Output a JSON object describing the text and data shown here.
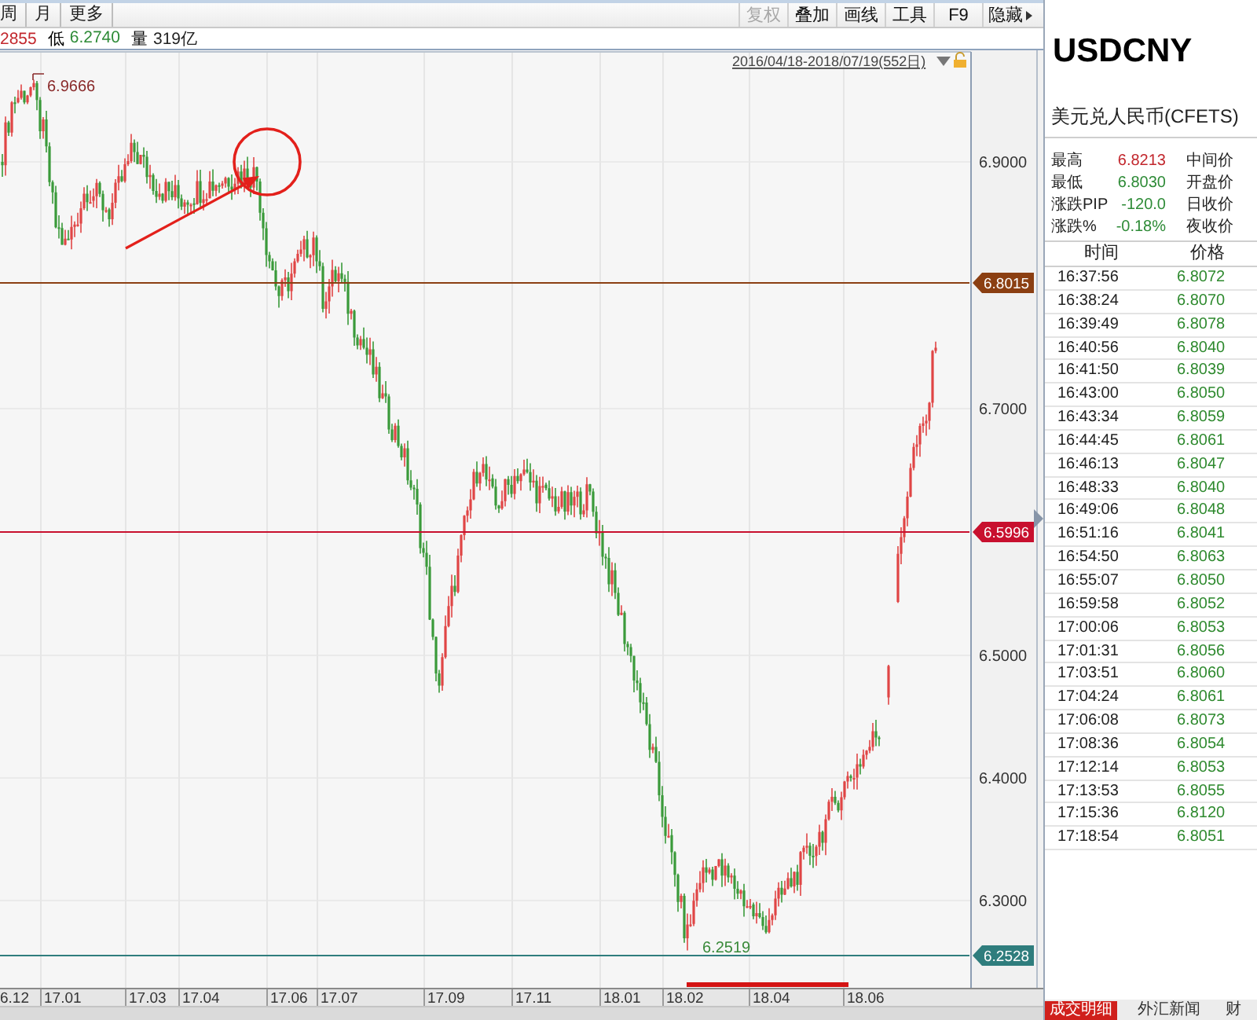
{
  "toolbar": {
    "period_tabs": [
      {
        "label": "周",
        "selected": false
      },
      {
        "label": "月",
        "selected": false
      },
      {
        "label": "更多",
        "selected": false
      }
    ],
    "buttons": [
      {
        "label": "复权",
        "kind": "plain",
        "disabled": true
      },
      {
        "label": "叠加",
        "kind": "plain",
        "disabled": false
      },
      {
        "label": "画线",
        "kind": "plain",
        "disabled": false
      },
      {
        "label": "工具",
        "kind": "plain",
        "disabled": false
      },
      {
        "label": "F9",
        "kind": "plain",
        "disabled": false
      },
      {
        "label": "隐藏",
        "kind": "menu",
        "disabled": false
      }
    ]
  },
  "quote_bar": [
    {
      "value": "2855",
      "color": "#c2272d"
    },
    {
      "label": "低",
      "value": "6.2740",
      "color": "#2e8b37"
    },
    {
      "label": "量",
      "value": "319亿",
      "color": "#222222"
    }
  ],
  "chart": {
    "range_label": "2016/04/18-2018/07/19(552日)",
    "price_ticks": [
      "6.9000",
      "6.7000",
      "6.5000",
      "6.4000",
      "6.3000"
    ],
    "reference_lines": [
      {
        "value": "6.8015",
        "color": "#8b3f12"
      },
      {
        "value": "6.5996",
        "color": "#c8102e"
      },
      {
        "value": "6.2528",
        "color": "#2f7d7d"
      }
    ],
    "high_label": "6.9666",
    "low_label": "6.2519",
    "time_ticks": [
      "6.12",
      "17.01",
      "17.03",
      "17.04",
      "17.06",
      "17.07",
      "17.09",
      "17.11",
      "18.01",
      "18.02",
      "18.04",
      "18.06"
    ]
  },
  "quote_panel": {
    "symbol": "USDCNY",
    "name": "美元兑人民币(CFETS)",
    "stats": [
      {
        "label": "最高",
        "value": "6.8213",
        "color": "#c2272d",
        "label_2": "中间价"
      },
      {
        "label": "最低",
        "value": "6.8030",
        "color": "#2e8b37",
        "label_2": "开盘价"
      },
      {
        "label": "涨跌PIP",
        "value": "-120.0",
        "color": "#2e8b37",
        "label_2": "日收价"
      },
      {
        "label": "涨跌%",
        "value": "-0.18%",
        "color": "#2e8b37",
        "label_2": "夜收价"
      }
    ],
    "columns": [
      "时间",
      "价格"
    ],
    "trades": [
      {
        "time": "16:37:56",
        "price": "6.8072"
      },
      {
        "time": "16:38:24",
        "price": "6.8070"
      },
      {
        "time": "16:39:49",
        "price": "6.8078"
      },
      {
        "time": "16:40:56",
        "price": "6.8040"
      },
      {
        "time": "16:41:50",
        "price": "6.8039"
      },
      {
        "time": "16:43:00",
        "price": "6.8050"
      },
      {
        "time": "16:43:34",
        "price": "6.8059"
      },
      {
        "time": "16:44:45",
        "price": "6.8061"
      },
      {
        "time": "16:46:13",
        "price": "6.8047"
      },
      {
        "time": "16:48:33",
        "price": "6.8040"
      },
      {
        "time": "16:49:06",
        "price": "6.8048"
      },
      {
        "time": "16:51:16",
        "price": "6.8041"
      },
      {
        "time": "16:54:50",
        "price": "6.8063"
      },
      {
        "time": "16:55:07",
        "price": "6.8050"
      },
      {
        "time": "16:59:58",
        "price": "6.8052"
      },
      {
        "time": "17:00:06",
        "price": "6.8053"
      },
      {
        "time": "17:01:31",
        "price": "6.8056"
      },
      {
        "time": "17:03:51",
        "price": "6.8060"
      },
      {
        "time": "17:04:24",
        "price": "6.8061"
      },
      {
        "time": "17:06:08",
        "price": "6.8073"
      },
      {
        "time": "17:08:36",
        "price": "6.8054"
      },
      {
        "time": "17:12:14",
        "price": "6.8053"
      },
      {
        "time": "17:13:53",
        "price": "6.8055"
      },
      {
        "time": "17:15:36",
        "price": "6.8120"
      },
      {
        "time": "17:18:54",
        "price": "6.8051"
      }
    ],
    "tabs": [
      {
        "label": "成交明细",
        "selected": true
      },
      {
        "label": "外汇新闻",
        "selected": false
      },
      {
        "label": "财",
        "selected": false
      }
    ]
  }
}
